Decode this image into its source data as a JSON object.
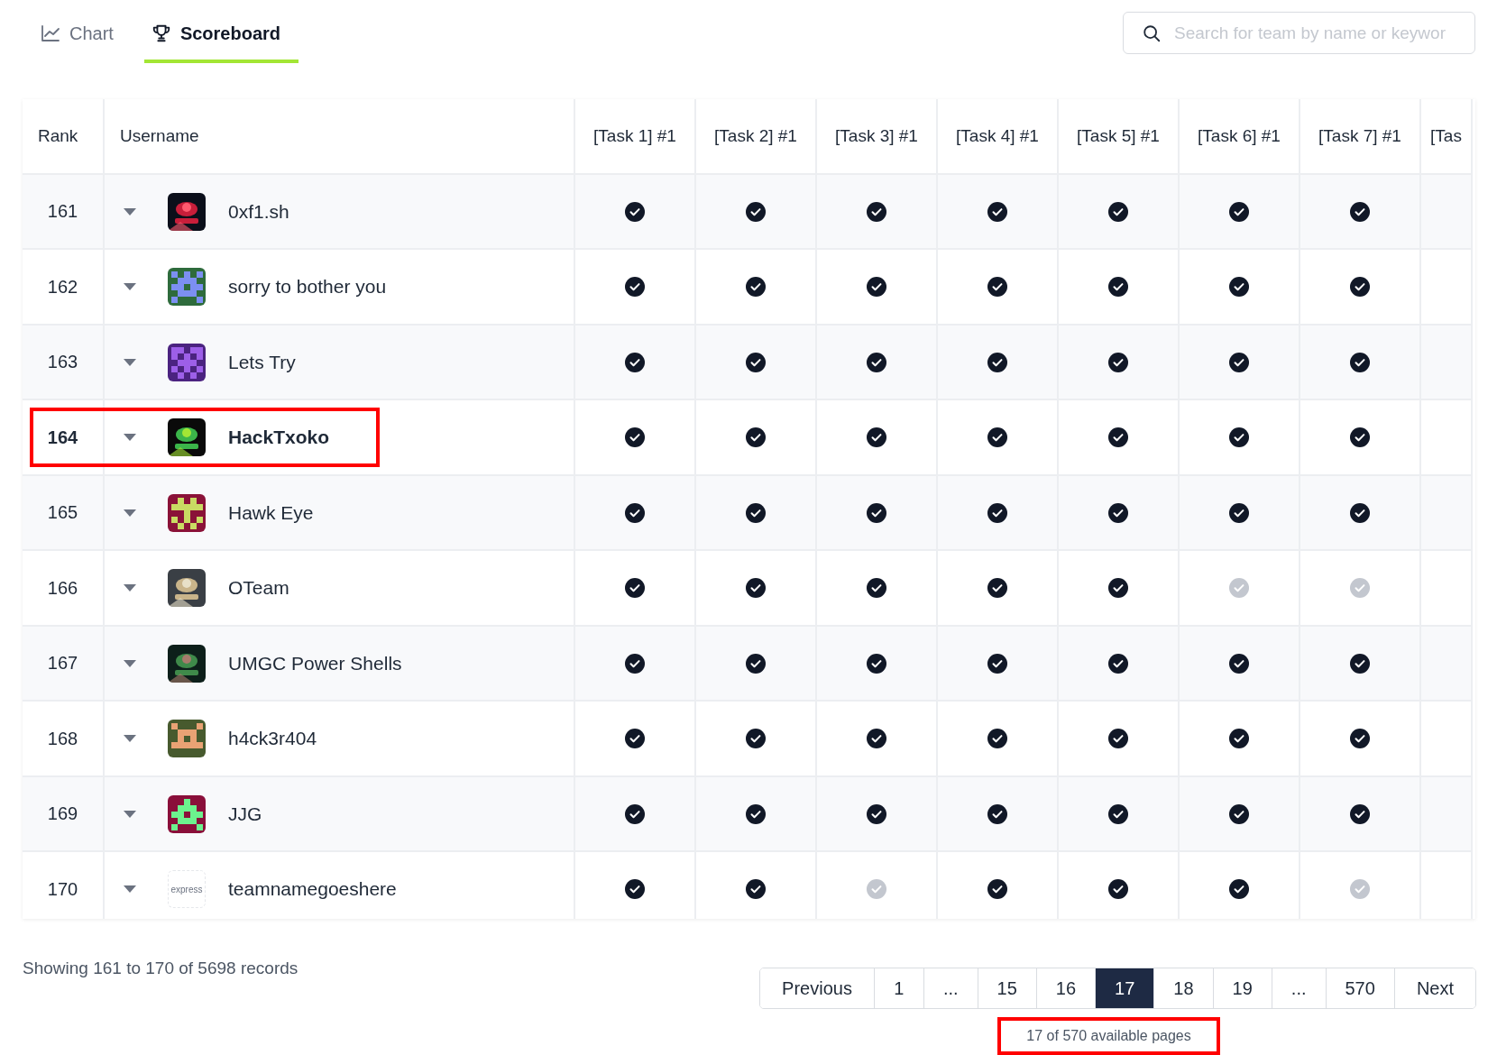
{
  "tabs": [
    {
      "label": "Chart",
      "selected": false
    },
    {
      "label": "Scoreboard",
      "selected": true
    }
  ],
  "search": {
    "placeholder": "Search for team by name or keywor"
  },
  "table": {
    "columns": [
      "Rank",
      "Username",
      "[Task 1] #1",
      "[Task 2] #1",
      "[Task 3] #1",
      "[Task 4] #1",
      "[Task 5] #1",
      "[Task 6] #1",
      "[Task 7] #1",
      "[Tas"
    ],
    "rows": [
      {
        "rank": "161",
        "name": "0xf1.sh",
        "highlighted": false,
        "solved": [
          true,
          true,
          true,
          true,
          true,
          true,
          true
        ]
      },
      {
        "rank": "162",
        "name": "sorry to bother you",
        "avatar": {
          "kind": "identicon",
          "color": "#2e6b3c"
        },
        "highlighted": false,
        "solved": [
          true,
          true,
          true,
          true,
          true,
          true,
          true
        ]
      },
      {
        "rank": "163",
        "name": "Lets Try",
        "avatar": {
          "kind": "identicon",
          "color": "#4b2380"
        },
        "highlighted": false,
        "solved": [
          true,
          true,
          true,
          true,
          true,
          true,
          true
        ]
      },
      {
        "rank": "164",
        "name": "HackTxoko",
        "highlighted": true,
        "solved": [
          true,
          true,
          true,
          true,
          true,
          true,
          true
        ]
      },
      {
        "rank": "165",
        "name": "Hawk Eye",
        "avatar": {
          "kind": "identicon",
          "color": "#8a1238"
        },
        "highlighted": false,
        "solved": [
          true,
          true,
          true,
          true,
          true,
          true,
          true
        ]
      },
      {
        "rank": "166",
        "name": "OTeam",
        "highlighted": false,
        "solved": [
          true,
          true,
          true,
          true,
          true,
          false,
          false
        ]
      },
      {
        "rank": "167",
        "name": "UMGC Power Shells",
        "highlighted": false,
        "solved": [
          true,
          true,
          true,
          true,
          true,
          true,
          true
        ]
      },
      {
        "rank": "168",
        "name": "h4ck3r404",
        "avatar": {
          "kind": "identicon",
          "color": "#475a2e"
        },
        "highlighted": false,
        "solved": [
          true,
          true,
          true,
          true,
          true,
          true,
          true
        ]
      },
      {
        "rank": "169",
        "name": "JJG",
        "avatar": {
          "kind": "identicon",
          "color": "#8a0f3a"
        },
        "highlighted": false,
        "solved": [
          true,
          true,
          true,
          true,
          true,
          true,
          true
        ]
      },
      {
        "rank": "170",
        "name": "teamnamegoeshere",
        "avatar": {
          "kind": "wordmark",
          "text": "express"
        },
        "highlighted": false,
        "solved": [
          true,
          true,
          false,
          true,
          true,
          true,
          false
        ]
      }
    ]
  },
  "footer": {
    "summary": "Showing 161 to 170 of 5698 records",
    "pages": [
      {
        "label": "Previous",
        "selected": false
      },
      {
        "label": "1",
        "selected": false
      },
      {
        "label": "...",
        "selected": false
      },
      {
        "label": "15",
        "selected": false
      },
      {
        "label": "16",
        "selected": false
      },
      {
        "label": "17",
        "selected": true
      },
      {
        "label": "18",
        "selected": false
      },
      {
        "label": "19",
        "selected": false
      },
      {
        "label": "...",
        "selected": false
      },
      {
        "label": "570",
        "selected": false
      },
      {
        "label": "Next",
        "selected": false
      }
    ],
    "page_info": "17 of 570 available pages",
    "page_info_highlighted": true
  }
}
